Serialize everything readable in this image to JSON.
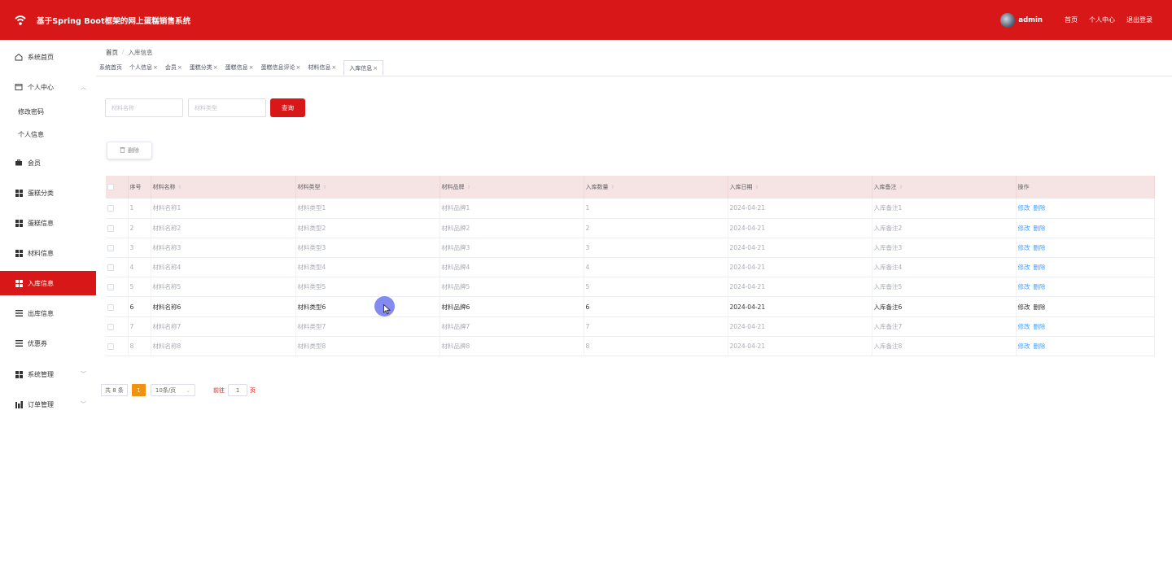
{
  "header": {
    "title": "基于Spring Boot框架的网上蛋糕销售系统",
    "user": "admin",
    "links": [
      "首页",
      "个人中心",
      "退出登录"
    ]
  },
  "sidebar": {
    "items": [
      {
        "label": "系统首页",
        "icon": "home-icon"
      },
      {
        "label": "个人中心",
        "icon": "window-icon"
      },
      {
        "label": "修改密码",
        "icon": ""
      },
      {
        "label": "个人信息",
        "icon": ""
      },
      {
        "label": "会员",
        "icon": "briefcase-icon"
      },
      {
        "label": "蛋糕分类",
        "icon": "grid-icon"
      },
      {
        "label": "蛋糕信息",
        "icon": "grid-icon"
      },
      {
        "label": "材料信息",
        "icon": "grid-icon"
      },
      {
        "label": "入库信息",
        "icon": "grid-icon"
      },
      {
        "label": "出库信息",
        "icon": "menu-icon"
      },
      {
        "label": "优惠券",
        "icon": "menu-icon"
      },
      {
        "label": "系统管理",
        "icon": "grid-icon"
      },
      {
        "label": "订单管理",
        "icon": "chart-icon"
      }
    ]
  },
  "breadcrumb": {
    "home": "首页",
    "sep": "/",
    "current": "入库信息"
  },
  "tabs": [
    "系统首页",
    "个人信息",
    "会员",
    "蛋糕分类",
    "蛋糕信息",
    "蛋糕信息评论",
    "材料信息",
    "入库信息"
  ],
  "tab_close": "×",
  "search": {
    "name_placeholder": "材料名称",
    "type_placeholder": "材料类型",
    "query_label": "查询"
  },
  "toolbar": {
    "delete_label": "删除"
  },
  "table": {
    "headers": [
      "序号",
      "材料名称",
      "材料类型",
      "材料品牌",
      "入库数量",
      "入库日期",
      "入库备注",
      "操作"
    ],
    "edit_label": "修改",
    "delete_label": "删除",
    "rows": [
      {
        "no": "1",
        "name": "材料名称1",
        "type": "材料类型1",
        "brand": "材料品牌1",
        "qty": "1",
        "date": "2024-04-21",
        "note": "入库备注1"
      },
      {
        "no": "2",
        "name": "材料名称2",
        "type": "材料类型2",
        "brand": "材料品牌2",
        "qty": "2",
        "date": "2024-04-21",
        "note": "入库备注2"
      },
      {
        "no": "3",
        "name": "材料名称3",
        "type": "材料类型3",
        "brand": "材料品牌3",
        "qty": "3",
        "date": "2024-04-21",
        "note": "入库备注3"
      },
      {
        "no": "4",
        "name": "材料名称4",
        "type": "材料类型4",
        "brand": "材料品牌4",
        "qty": "4",
        "date": "2024-04-21",
        "note": "入库备注4"
      },
      {
        "no": "5",
        "name": "材料名称5",
        "type": "材料类型5",
        "brand": "材料品牌5",
        "qty": "5",
        "date": "2024-04-21",
        "note": "入库备注5"
      },
      {
        "no": "6",
        "name": "材料名称6",
        "type": "材料类型6",
        "brand": "材料品牌6",
        "qty": "6",
        "date": "2024-04-21",
        "note": "入库备注6"
      },
      {
        "no": "7",
        "name": "材料名称7",
        "type": "材料类型7",
        "brand": "材料品牌7",
        "qty": "7",
        "date": "2024-04-21",
        "note": "入库备注7"
      },
      {
        "no": "8",
        "name": "材料名称8",
        "type": "材料类型8",
        "brand": "材料品牌8",
        "qty": "8",
        "date": "2024-04-21",
        "note": "入库备注8"
      }
    ]
  },
  "pagination": {
    "total": "共 8 条",
    "current_page": "1",
    "page_size": "10条/页",
    "goto": "前往",
    "goto_value": "1",
    "page_suffix": "页"
  }
}
